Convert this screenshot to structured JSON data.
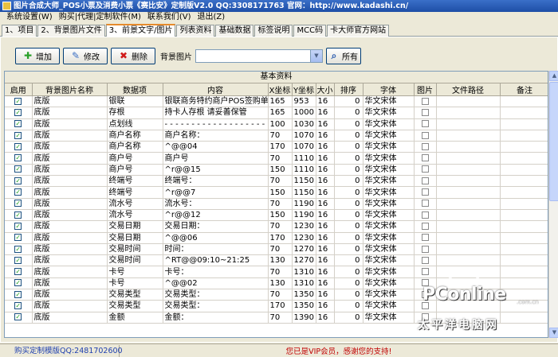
{
  "window": {
    "title": "图片合成大师_POS小票及消费小票《赛比安》定制版V2.0 QQ:3308171763 官网：http://www.kadashi.cn/"
  },
  "menu": [
    "系统设置(W)",
    "购买|代理|定制软件(M)",
    "联系我们(V)",
    "退出(Z)"
  ],
  "tabs": [
    "1、项目",
    "2、背景图片文件",
    "3、前景文字/图片",
    "列表资料",
    "基础数据",
    "标签说明",
    "MCC码",
    "卡大师官方网站"
  ],
  "active_tab": 2,
  "toolbar": {
    "add_label": "增加",
    "edit_label": "修改",
    "delete_label": "删除",
    "bg_image_label": "背景图片",
    "bg_image_value": "",
    "all_label": "所有"
  },
  "grid": {
    "group_title": "基本资料",
    "columns": [
      "启用",
      "背景图片名称",
      "数据项",
      "内容",
      "X坐标",
      "Y坐标",
      "大小",
      "排序",
      "字体",
      "图片",
      "文件路径",
      "备注"
    ],
    "rows": [
      {
        "enabled": true,
        "bg": "底版",
        "item": "银联",
        "content": "银联商务特约商户POS签购单",
        "x": "165",
        "y": "953",
        "size": "16",
        "order": "0",
        "font": "华文宋体"
      },
      {
        "enabled": true,
        "bg": "底版",
        "item": "存根",
        "content": "持卡人存根        请妥善保管",
        "x": "165",
        "y": "1000",
        "size": "16",
        "order": "0",
        "font": "华文宋体"
      },
      {
        "enabled": true,
        "bg": "底版",
        "item": "点划线",
        "content": "- - - - - - - - - - - - - - - - - - - - - - - - - -",
        "x": "100",
        "y": "1030",
        "size": "16",
        "order": "0",
        "font": "华文宋体"
      },
      {
        "enabled": true,
        "bg": "底版",
        "item": "商户名称",
        "content": "商户名称：",
        "x": "70",
        "y": "1070",
        "size": "16",
        "order": "0",
        "font": "华文宋体"
      },
      {
        "enabled": true,
        "bg": "底版",
        "item": "商户名称",
        "content": "^@@04",
        "x": "170",
        "y": "1070",
        "size": "16",
        "order": "0",
        "font": "华文宋体"
      },
      {
        "enabled": true,
        "bg": "底版",
        "item": "商户号",
        "content": "商户号",
        "x": "70",
        "y": "1110",
        "size": "16",
        "order": "0",
        "font": "华文宋体"
      },
      {
        "enabled": true,
        "bg": "底版",
        "item": "商户号",
        "content": "^r@@15",
        "x": "150",
        "y": "1110",
        "size": "16",
        "order": "0",
        "font": "华文宋体"
      },
      {
        "enabled": true,
        "bg": "底版",
        "item": "终端号",
        "content": "终端号：",
        "x": "70",
        "y": "1150",
        "size": "16",
        "order": "0",
        "font": "华文宋体"
      },
      {
        "enabled": true,
        "bg": "底版",
        "item": "终端号",
        "content": "^r@@7",
        "x": "150",
        "y": "1150",
        "size": "16",
        "order": "0",
        "font": "华文宋体"
      },
      {
        "enabled": true,
        "bg": "底版",
        "item": "流水号",
        "content": "流水号：",
        "x": "70",
        "y": "1190",
        "size": "16",
        "order": "0",
        "font": "华文宋体"
      },
      {
        "enabled": true,
        "bg": "底版",
        "item": "流水号",
        "content": "^r@@12",
        "x": "150",
        "y": "1190",
        "size": "16",
        "order": "0",
        "font": "华文宋体"
      },
      {
        "enabled": true,
        "bg": "底版",
        "item": "交易日期",
        "content": "交易日期：",
        "x": "70",
        "y": "1230",
        "size": "16",
        "order": "0",
        "font": "华文宋体"
      },
      {
        "enabled": true,
        "bg": "底版",
        "item": "交易日期",
        "content": "^@@06",
        "x": "170",
        "y": "1230",
        "size": "16",
        "order": "0",
        "font": "华文宋体"
      },
      {
        "enabled": true,
        "bg": "底版",
        "item": "交易时间",
        "content": "时间：",
        "x": "70",
        "y": "1270",
        "size": "16",
        "order": "0",
        "font": "华文宋体"
      },
      {
        "enabled": true,
        "bg": "底版",
        "item": "交易时间",
        "content": "^RT@@09:10~21:25",
        "x": "130",
        "y": "1270",
        "size": "16",
        "order": "0",
        "font": "华文宋体"
      },
      {
        "enabled": true,
        "bg": "底版",
        "item": "卡号",
        "content": "卡号：",
        "x": "70",
        "y": "1310",
        "size": "16",
        "order": "0",
        "font": "华文宋体"
      },
      {
        "enabled": true,
        "bg": "底版",
        "item": "卡号",
        "content": "^@@02",
        "x": "130",
        "y": "1310",
        "size": "16",
        "order": "0",
        "font": "华文宋体"
      },
      {
        "enabled": true,
        "bg": "底版",
        "item": "交易类型",
        "content": "交易类型：",
        "x": "70",
        "y": "1350",
        "size": "16",
        "order": "0",
        "font": "华文宋体"
      },
      {
        "enabled": true,
        "bg": "底版",
        "item": "交易类型",
        "content": "交易类型：",
        "x": "170",
        "y": "1350",
        "size": "16",
        "order": "0",
        "font": "华文宋体"
      },
      {
        "enabled": true,
        "bg": "底版",
        "item": "金额",
        "content": "金额：",
        "x": "70",
        "y": "1390",
        "size": "16",
        "order": "0",
        "font": "华文宋体"
      }
    ]
  },
  "status": {
    "left": "购买定制模版QQ:2481702600",
    "middle": "您已是VIP会员，感谢您的支持!"
  },
  "watermark": {
    "brand": "PConline",
    "domain": ".com.cn",
    "cn": "太平洋电脑网"
  }
}
